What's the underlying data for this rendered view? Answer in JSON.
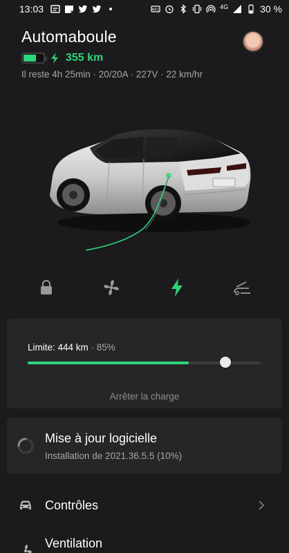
{
  "status_bar": {
    "time": "13:03",
    "network": "4G",
    "battery": "30 %"
  },
  "vehicle": {
    "name": "Automaboule",
    "range": "355 km",
    "battery_level": 0.65,
    "charge_details": "Il reste 4h 25min · 20/20A · 227V · 22 km/hr"
  },
  "controls": {
    "icons": [
      "lock-icon",
      "fan-icon",
      "bolt-icon",
      "car-trunk-icon"
    ],
    "active": "bolt-icon"
  },
  "charging": {
    "limit_label": "Limite: 444 km",
    "limit_pct": " · 85%",
    "current_level": 0.69,
    "limit_level": 0.85,
    "stop_label": "Arrêter la charge"
  },
  "update": {
    "title": "Mise à jour logicielle",
    "subtitle": "Installation de 2021.36.5.5 (10%)"
  },
  "menu": {
    "items": [
      {
        "label": "Contrôles",
        "icon": "car-front-icon"
      },
      {
        "label": "Ventilation",
        "icon": "fan-icon"
      }
    ]
  },
  "colors": {
    "background": "#1b1b1d",
    "card": "#262628",
    "accent_green": "#2ed47a"
  }
}
